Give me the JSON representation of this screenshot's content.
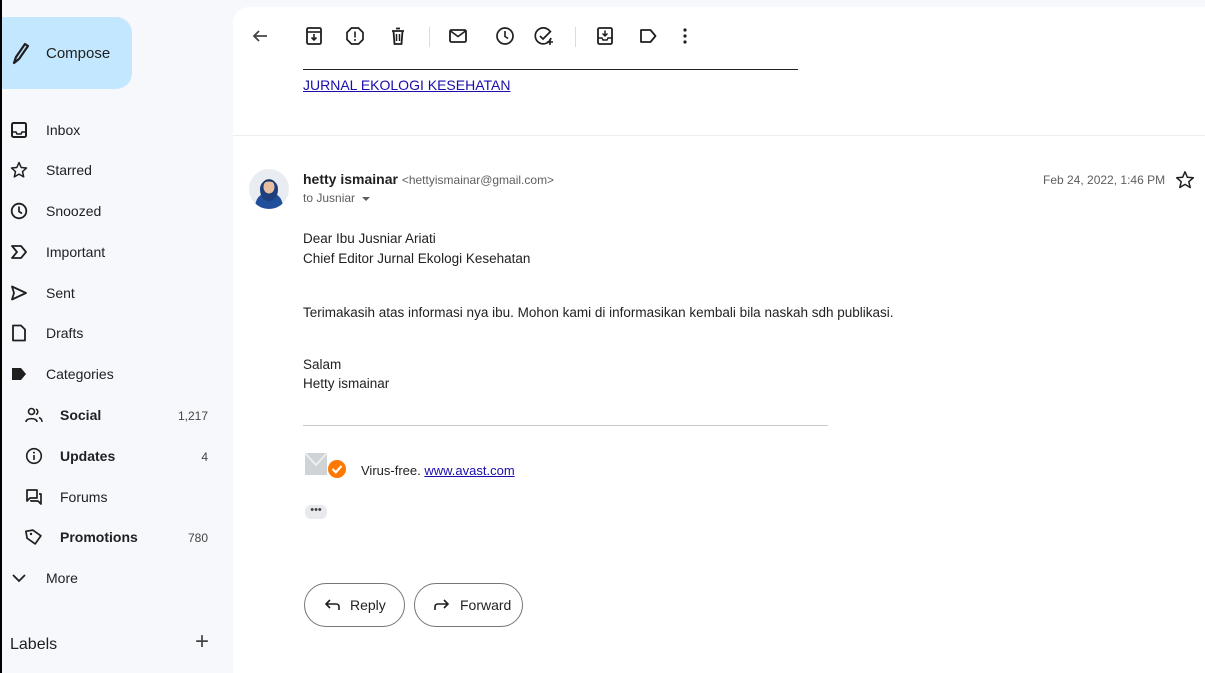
{
  "sidebar": {
    "compose_label": "Compose",
    "items": [
      {
        "label": "Inbox"
      },
      {
        "label": "Starred"
      },
      {
        "label": "Snoozed"
      },
      {
        "label": "Important"
      },
      {
        "label": "Sent"
      },
      {
        "label": "Drafts"
      },
      {
        "label": "Categories"
      },
      {
        "label": "Social",
        "count": "1,217"
      },
      {
        "label": "Updates",
        "count": "4"
      },
      {
        "label": "Forums"
      },
      {
        "label": "Promotions",
        "count": "780"
      },
      {
        "label": "More"
      }
    ],
    "labels_heading": "Labels",
    "labels_add": "+"
  },
  "message": {
    "subject_link": "JURNAL EKOLOGI KESEHATAN",
    "sender_name": "hetty ismainar",
    "sender_email": "<hettyismainar@gmail.com>",
    "recipient": "to Jusniar",
    "date": "Feb 24, 2022, 1:46 PM",
    "body": [
      "Dear Ibu Jusniar Ariati",
      "Chief Editor Jurnal Ekologi Kesehatan",
      "Terimakasih atas informasi nya ibu. Mohon kami di informasikan kembali bila naskah sdh publikasi.",
      "Salam",
      "Hetty ismainar"
    ],
    "avast_prefix": "Virus-free.",
    "avast_link": "www.avast.com",
    "trim_dots": "•••"
  },
  "actions": {
    "reply": "Reply",
    "forward": "Forward"
  },
  "icons": {
    "compose": "pencil-icon",
    "back": "arrow-left-icon",
    "archive": "archive-icon",
    "spam": "report-spam-icon",
    "delete": "trash-icon",
    "mark_unread": "envelope-icon",
    "snooze": "clock-icon",
    "add_task": "add-task-icon",
    "move": "move-to-icon",
    "label": "label-icon",
    "more": "more-vertical-icon"
  },
  "colors": {
    "compose_bg": "#c2e7ff",
    "link": "#1a0dab",
    "avast_orange": "#ff7800"
  }
}
